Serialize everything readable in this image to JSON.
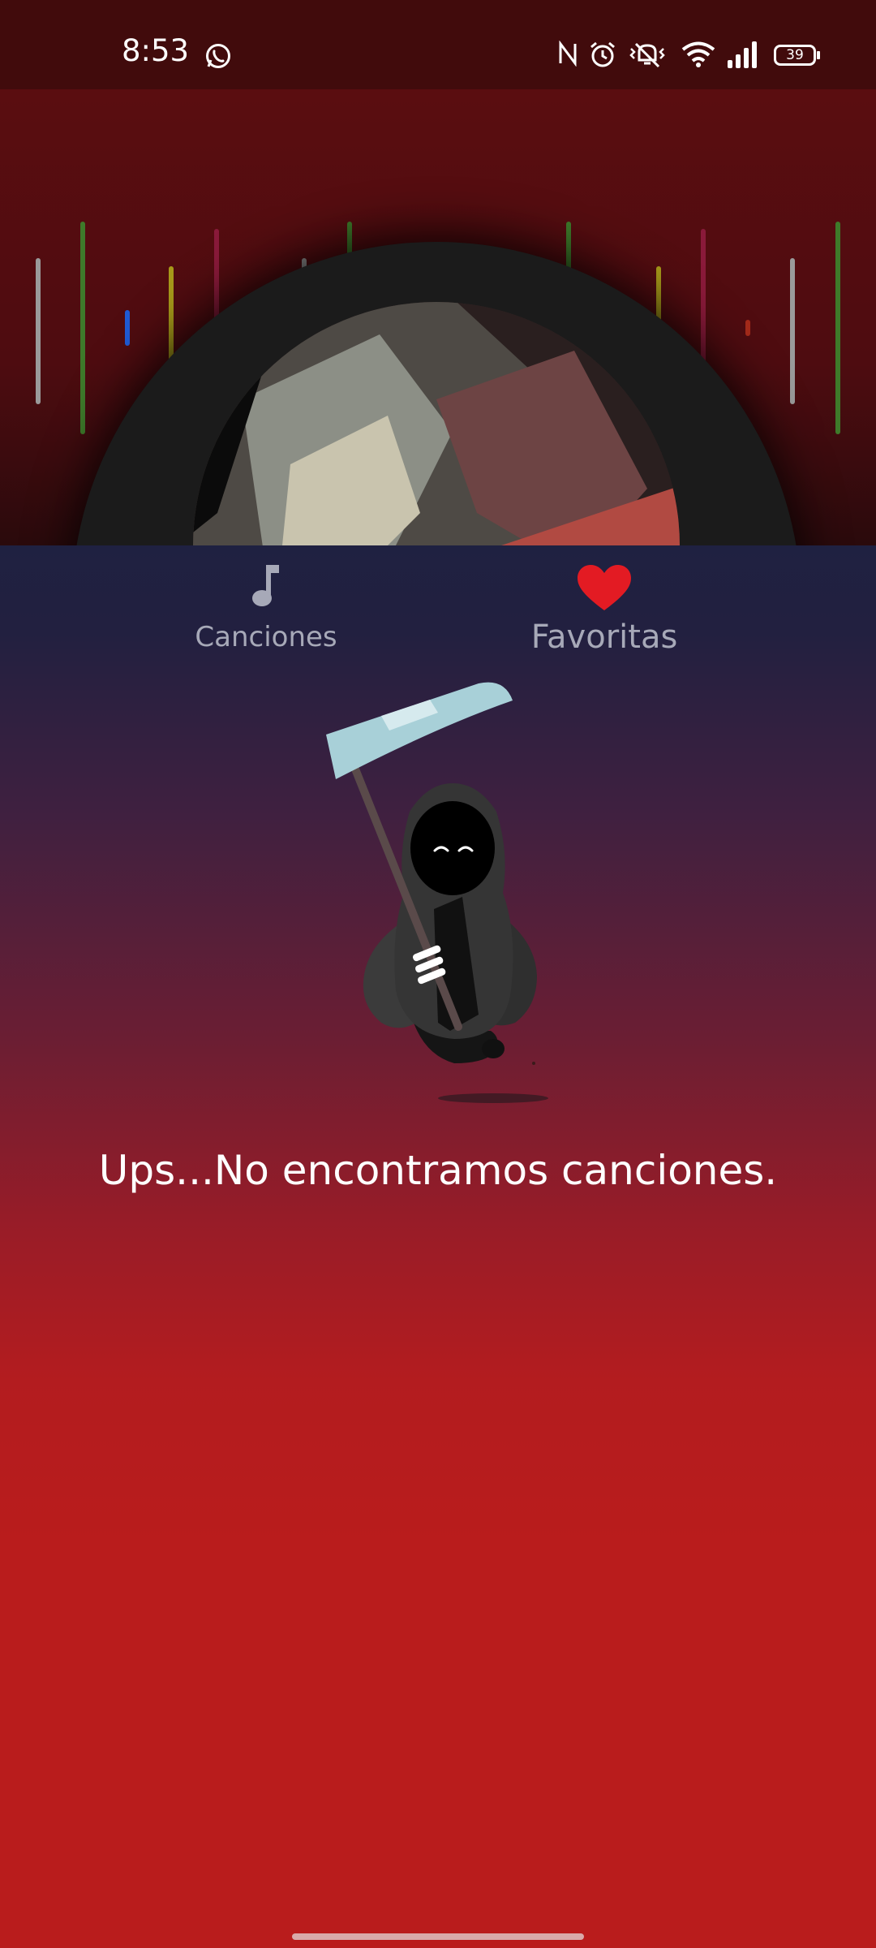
{
  "status_bar": {
    "time": "8:53",
    "battery": "39",
    "icons": [
      "whatsapp-icon",
      "nfc-icon",
      "alarm-icon",
      "vibrate-icon",
      "wifi-icon",
      "signal-icon",
      "battery-icon"
    ]
  },
  "tabs": [
    {
      "label": "Canciones",
      "icon": "music-note-icon"
    },
    {
      "label": "Favoritas",
      "icon": "heart-icon",
      "selected": true
    }
  ],
  "empty_state": {
    "message": "Ups...No encontramos canciones."
  },
  "colors": {
    "header": "#5a0d10",
    "status_bar": "#410b0c",
    "tab_bar": "#1f2141",
    "accent_heart": "#e31b23",
    "background_bottom": "#b91c1c"
  }
}
